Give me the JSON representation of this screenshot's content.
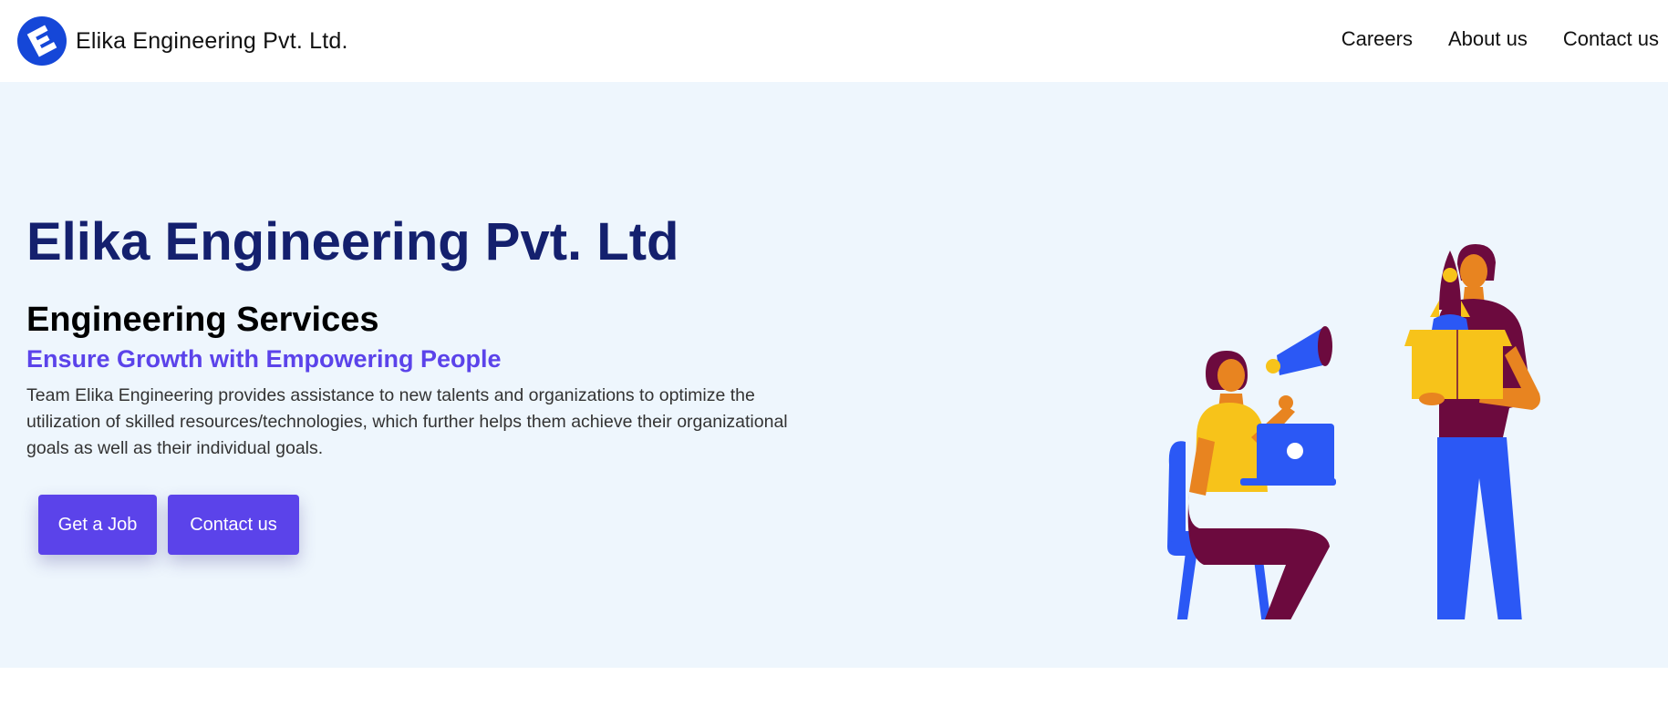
{
  "navbar": {
    "brand_name": "Elika Engineering Pvt. Ltd.",
    "links": [
      {
        "label": "Careers"
      },
      {
        "label": "About us"
      },
      {
        "label": "Contact us"
      }
    ]
  },
  "hero": {
    "title": "Elika Engineering Pvt. Ltd",
    "subtitle": "Engineering Services",
    "tagline": "Ensure Growth with Empowering People",
    "description": "Team Elika Engineering provides assistance to new talents and organizations to optimize the utilization of skilled resources/technologies, which further helps them achieve their organizational goals as well as their individual goals.",
    "buttons": {
      "get_job": "Get a Job",
      "contact": "Contact us"
    }
  },
  "colors": {
    "brand_blue": "#1547d8",
    "hero_bg": "#eef6fd",
    "title_navy": "#14206e",
    "accent_purple": "#5b43ea",
    "illustration_yellow": "#f7c31a",
    "illustration_blue": "#2b58f5",
    "illustration_maroon": "#6c0a3e",
    "illustration_skin": "#e88420"
  },
  "icons": {
    "logo": "elika-e-logo-icon",
    "illustration": "team-megaphone-laptop-rocket-box-illustration"
  }
}
